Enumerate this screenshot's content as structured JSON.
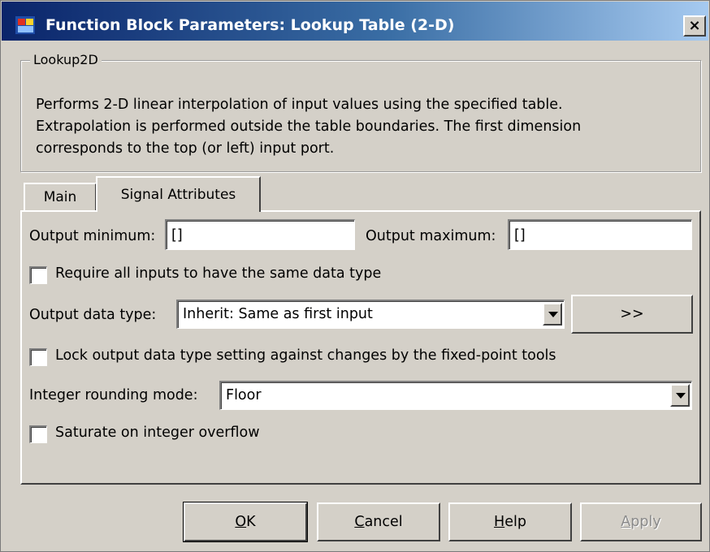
{
  "window": {
    "title": "Function Block Parameters: Lookup Table (2-D)",
    "close_label": "×",
    "icon": "simulink-block-icon"
  },
  "group": {
    "legend": "Lookup2D",
    "description": [
      "Performs 2-D linear interpolation of input values using the specified table.",
      "Extrapolation is performed outside the table boundaries.  The first dimension",
      "corresponds to the top (or left) input port."
    ]
  },
  "tabs": [
    {
      "label": "Main",
      "active": false
    },
    {
      "label": "Signal Attributes",
      "active": true
    }
  ],
  "signal_attributes": {
    "output_minimum": {
      "label": "Output minimum:",
      "value": "[]"
    },
    "output_maximum": {
      "label": "Output maximum:",
      "value": "[]"
    },
    "require_same_type": {
      "label": "Require all inputs to have the same data type",
      "checked": false
    },
    "output_data_type": {
      "label": "Output data type:",
      "value": "Inherit: Same as first input",
      "assistant_button": ">>"
    },
    "lock_output_type": {
      "label": "Lock output data type setting against changes by the fixed-point tools",
      "checked": false
    },
    "integer_rounding": {
      "label": "Integer rounding mode:",
      "value": "Floor"
    },
    "saturate_overflow": {
      "label": "Saturate on integer overflow",
      "checked": false
    }
  },
  "buttons": {
    "ok": {
      "mnemonic": "O",
      "rest": "K"
    },
    "cancel": {
      "mnemonic": "C",
      "rest": "ancel"
    },
    "help": {
      "mnemonic": "H",
      "rest": "elp"
    },
    "apply": {
      "mnemonic": "A",
      "rest": "pply",
      "enabled": false
    }
  },
  "colors": {
    "face": "#d4d0c8",
    "title_start": "#0a246a",
    "title_end": "#a6caf0"
  }
}
